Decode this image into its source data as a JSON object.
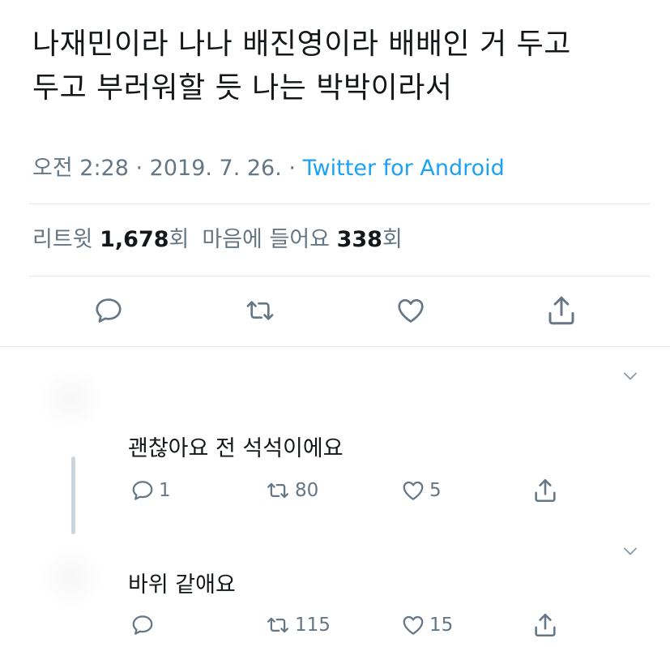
{
  "tweet": {
    "line1": "나재민이라 나나 배진영이라 배배인 거 두고",
    "line2": "두고 부러워할 듯 나는 박박이라서",
    "time": "오전 2:28",
    "sep1": " · ",
    "date": "2019. 7. 26.",
    "sep2": " · ",
    "source": "Twitter for Android"
  },
  "stats": {
    "retweet_label": "리트윗",
    "retweet_count": "1,678",
    "retweet_unit": "회",
    "like_label": "마음에 들어요",
    "like_count": "338",
    "like_unit": "회"
  },
  "actions": {
    "reply_icon": "reply-icon",
    "retweet_icon": "retweet-icon",
    "like_icon": "heart-icon",
    "share_icon": "share-icon"
  },
  "replies": [
    {
      "text": "괜찮아요 전 석석이에요",
      "reply_count": "1",
      "retweet_count": "80",
      "like_count": "5"
    },
    {
      "text": "바위 같애요",
      "reply_count": "",
      "retweet_count": "115",
      "like_count": "15"
    }
  ],
  "colors": {
    "text": "#14171a",
    "secondary": "#657786",
    "link": "#1da1f2",
    "divider": "#e1e8ed"
  }
}
